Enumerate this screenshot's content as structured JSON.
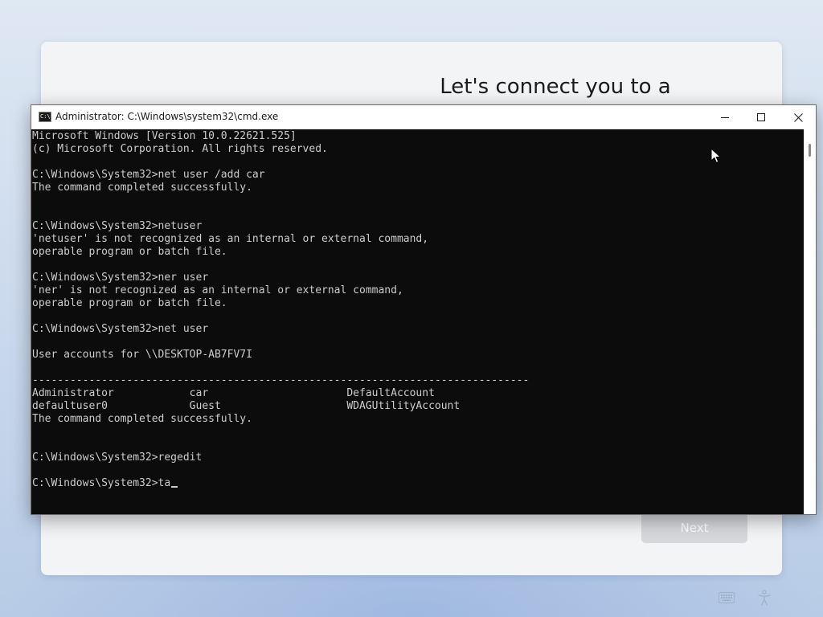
{
  "oobe": {
    "title": "Let's connect you to a network",
    "next_label": "Next"
  },
  "cmd": {
    "title": "Administrator: C:\\Windows\\system32\\cmd.exe",
    "icon_text": "C:\\",
    "lines": [
      "Microsoft Windows [Version 10.0.22621.525]",
      "(c) Microsoft Corporation. All rights reserved.",
      "",
      "C:\\Windows\\System32>net user /add car",
      "The command completed successfully.",
      "",
      "",
      "C:\\Windows\\System32>netuser",
      "'netuser' is not recognized as an internal or external command,",
      "operable program or batch file.",
      "",
      "C:\\Windows\\System32>ner user",
      "'ner' is not recognized as an internal or external command,",
      "operable program or batch file.",
      "",
      "C:\\Windows\\System32>net user",
      "",
      "User accounts for \\\\DESKTOP-AB7FV7I",
      "",
      "-------------------------------------------------------------------------------",
      "Administrator            car                      DefaultAccount",
      "defaultuser0             Guest                    WDAGUtilityAccount",
      "The command completed successfully.",
      "",
      "",
      "C:\\Windows\\System32>regedit",
      "",
      "C:\\Windows\\System32>ta"
    ]
  },
  "icons": {
    "app": "cmd-icon",
    "minimize": "minimize-icon",
    "maximize": "maximize-icon",
    "close": "close-icon",
    "keyboard": "keyboard-icon",
    "accessibility": "accessibility-icon",
    "pointer": "mouse-pointer-icon"
  }
}
